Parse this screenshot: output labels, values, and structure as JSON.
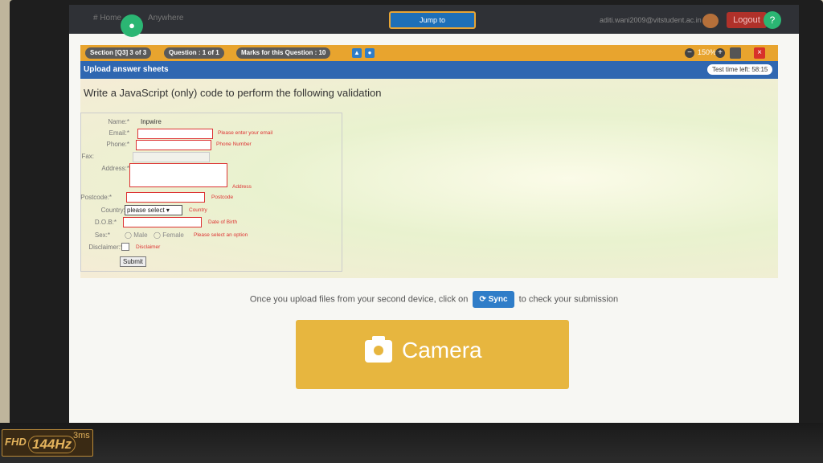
{
  "topnav": {
    "home": "# Home",
    "anywhere": "Anywhere",
    "jump_to": "Jump to",
    "user_email": "aditi.wani2009@vitstudent.ac.in",
    "logout": "Logout"
  },
  "exam_bar": {
    "section": "Section [Q3] 3 of 3",
    "question": "Question : 1 of 1",
    "marks": "Marks for this Question : 10",
    "zoom": "150%"
  },
  "upload_bar": {
    "title": "Upload answer sheets",
    "time_left": "Test time left: 58:15"
  },
  "question": {
    "text": "Write a JavaScript (only) code to perform the following validation",
    "form": {
      "name_label": "Name:*",
      "name_value": "Inpwire",
      "email_label": "Email:*",
      "email_hint": "Please enter your email",
      "phone_label": "Phone:*",
      "phone_hint": "Phone Number",
      "fax_label": "Fax:",
      "address_label": "Address:*",
      "address_hint": "Address",
      "postcode_label": "Postcode:*",
      "postcode_hint": "Postcode",
      "country_label": "Country:*",
      "country_select": "please select",
      "country_hint": "Country",
      "dob_label": "D.O.B:*",
      "dob_hint": "Date of Birth",
      "sex_label": "Sex:*",
      "sex_male": "Male",
      "sex_female": "Female",
      "sex_hint": "Please select an option",
      "disclaimer_label": "Disclaimer:*",
      "disclaimer_hint": "Disclaimer",
      "submit": "Submit"
    }
  },
  "sync": {
    "before": "Once you upload files from your second device, click on",
    "button": "Sync",
    "after": "to check your submission"
  },
  "camera": {
    "label": "Camera"
  },
  "monitor": {
    "fhd": "FHD",
    "hz": "144Hz",
    "ms": "3ms"
  }
}
